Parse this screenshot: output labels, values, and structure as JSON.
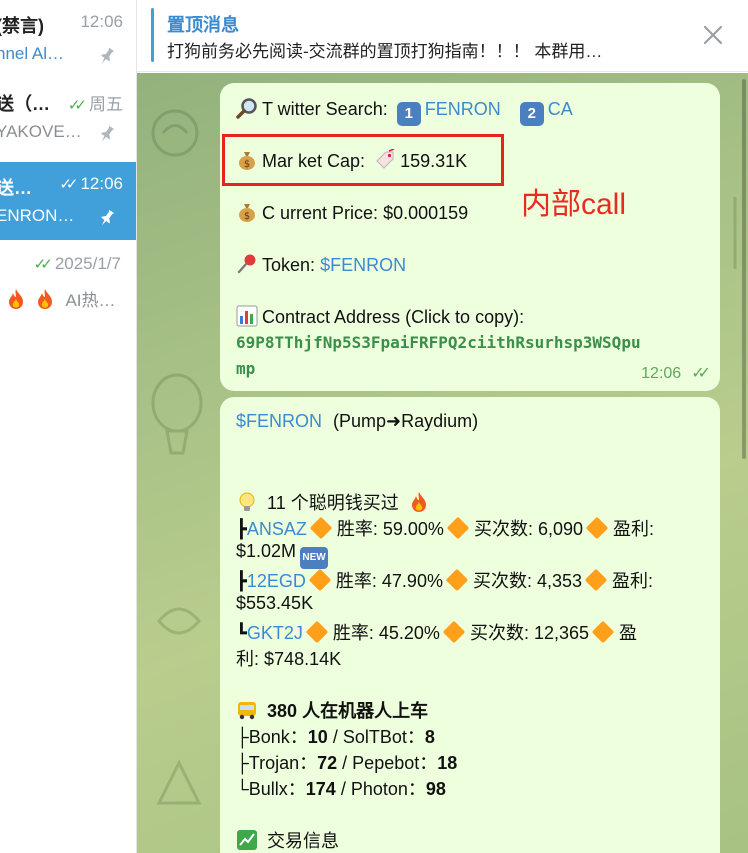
{
  "sidebar": {
    "chats": [
      {
        "name": "(禁言)",
        "time": "12:06",
        "preview": "nnel Al…",
        "preview_is_link": true,
        "pinned": true
      },
      {
        "name": "送（…",
        "time": "周五",
        "preview": "YAKOVE…",
        "preview_is_link": false,
        "pinned": true
      },
      {
        "name": "送…",
        "time": "12:06",
        "preview": "ENRON…",
        "preview_is_link": false,
        "pinned": true,
        "active": true
      },
      {
        "name": "",
        "time": "2025/1/7",
        "preview": "AI热…",
        "preview_is_link": false,
        "pinned": false
      }
    ]
  },
  "pinned": {
    "title": "置顶消息",
    "text": "打狗前务必先阅读-交流群的置顶打狗指南！！！ 本群用…"
  },
  "message1": {
    "search_label": "T witter Search:",
    "key1": "1",
    "search_link1": "FENRON",
    "key2": "2",
    "search_link2": "CA",
    "market_cap_label": "Mar ket Cap:",
    "market_cap_value": "159.31K",
    "price_label": "C urrent Price:",
    "price_value": "$0.000159",
    "token_label": "Token:",
    "token_value": "$FENRON",
    "contract_label": "Contract Address (Click to copy):",
    "contract_line1": "69P8TThjfNp5S3FpaiFRFPQ2ciithRsurhsp3WSQpu",
    "contract_line2": "mp",
    "time": "12:06"
  },
  "annotation": {
    "label": "内部call",
    "color": "#ea2a1f"
  },
  "message2": {
    "token": "$FENRON",
    "route": "(Pump➜Raydium)",
    "smart_title": "11 个聪明钱买过",
    "wallets": [
      {
        "prefix": "┣",
        "name": "ANSAZ",
        "winrate_label": "胜率:",
        "winrate": "59.00%",
        "buys_label": "买次数:",
        "buys": "6,090",
        "profit_label": "盈利:",
        "profit": "$1.02M",
        "badge": "NEW"
      },
      {
        "prefix": "┣",
        "name": "12EGD",
        "winrate_label": "胜率:",
        "winrate": "47.90%",
        "buys_label": "买次数:",
        "buys": "4,353",
        "profit_label": "盈利:",
        "profit": "$553.45K"
      },
      {
        "prefix": "┗",
        "name": "GKT2J",
        "winrate_label": "胜率:",
        "winrate": "45.20%",
        "buys_label": "买次数:",
        "buys": "12,365",
        "profit_label_part1": "盈",
        "profit_label_part2": "利:",
        "profit": "$748.14K"
      }
    ],
    "bots_count": "380",
    "bots_title": "人在机器人上车",
    "bots": [
      {
        "prefix": "├",
        "a": "Bonk",
        "a_val": "10",
        "b": "SolTBot",
        "b_val": "8"
      },
      {
        "prefix": "├",
        "a": "Trojan",
        "a_val": "72",
        "b": "Pepebot",
        "b_val": "18"
      },
      {
        "prefix": "└",
        "a": "Bullx",
        "a_val": "174",
        "b": "Photon",
        "b_val": "98"
      }
    ],
    "trade_title": "交易信息"
  },
  "colors": {
    "accent": "#419fd9",
    "link": "#3a8bd1",
    "bubble": "#eeffde",
    "check": "#4fae4e",
    "highlight": "#e52420"
  }
}
